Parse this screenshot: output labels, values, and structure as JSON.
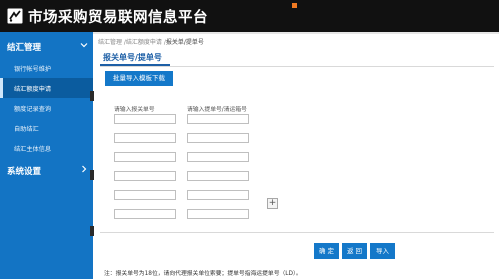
{
  "app": {
    "title": "市场采购贸易联网信息平台"
  },
  "sidebar": {
    "groups": [
      {
        "label": "结汇管理",
        "items": [
          {
            "label": "银行帐号维护",
            "active": false
          },
          {
            "label": "结汇额度申请",
            "active": true
          },
          {
            "label": "额度记录查询",
            "active": false
          },
          {
            "label": "自助结汇",
            "active": false
          },
          {
            "label": "结汇主体信息",
            "active": false
          }
        ]
      },
      {
        "label": "系统设置",
        "items": []
      }
    ]
  },
  "breadcrumb": {
    "path": "结汇管理 /结汇额度申请 /",
    "current": "报关单/提单号"
  },
  "tab": {
    "label": "报关单号/提单号"
  },
  "buttons": {
    "batch_import_template_download": "批量导入模板下载",
    "confirm": "确 定",
    "back": "返 回",
    "import": "导入"
  },
  "form": {
    "columns": [
      "请输入报关单号",
      "请输入提单号/清运箱号"
    ],
    "rows": [
      [
        "",
        ""
      ],
      [
        "",
        ""
      ],
      [
        "",
        ""
      ],
      [
        "",
        ""
      ],
      [
        "",
        ""
      ],
      [
        "",
        ""
      ]
    ]
  },
  "add_row_symbol": "+",
  "note": "注：报关单号为18位，请向代理报关单位索要；提单号指海运提单号（LD）。",
  "colors": {
    "topbar": "#111111",
    "sidebar": "#1374c4",
    "sidebar_active": "#0b5c9f",
    "primary_button": "#1478c9"
  },
  "icons": {
    "logo": "logo-icon",
    "expand": "chevron-down-icon",
    "collapsed": "chevron-right-icon",
    "add": "plus-icon"
  }
}
